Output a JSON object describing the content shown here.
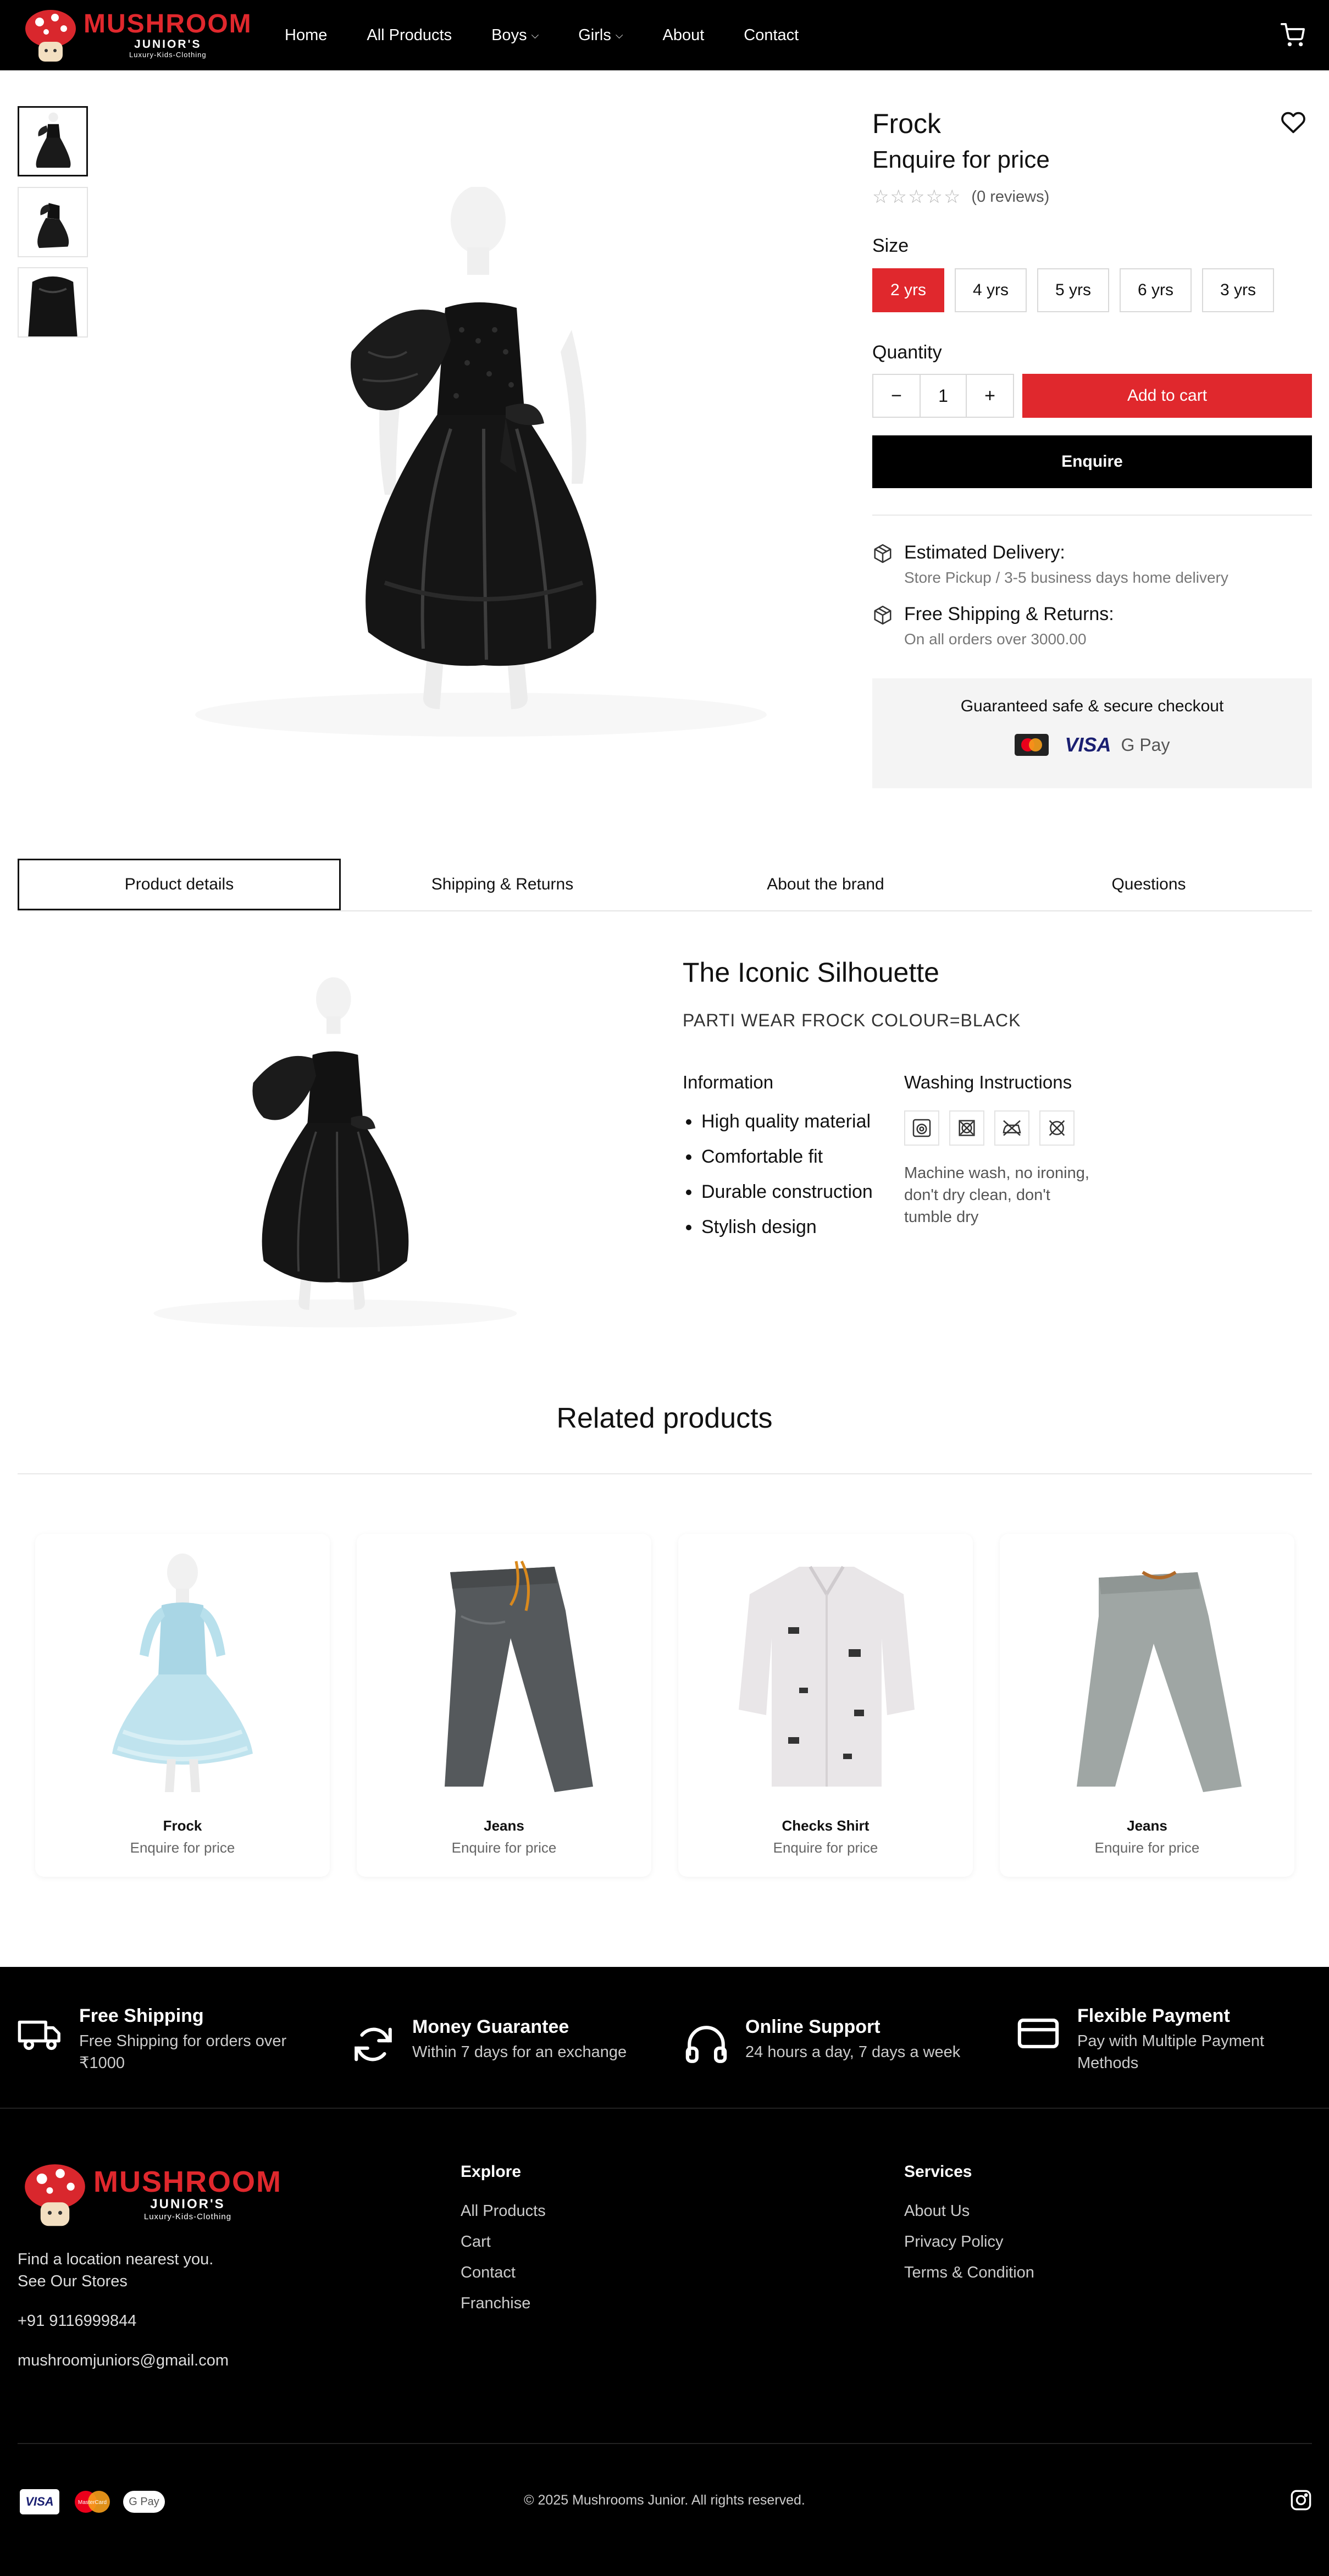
{
  "brand": {
    "name_main": "MUSHROOM",
    "name_sub": "JUNIOR'S",
    "tagline": "Luxury-Kids-Clothing"
  },
  "nav": {
    "items": [
      {
        "label": "Home"
      },
      {
        "label": "All Products"
      },
      {
        "label": "Boys"
      },
      {
        "label": "Girls"
      },
      {
        "label": "About"
      },
      {
        "label": "Contact"
      }
    ]
  },
  "product": {
    "title": "Frock",
    "price": "Enquire for price",
    "reviews": "(0 reviews)",
    "rating": 0,
    "size_label": "Size",
    "sizes": [
      "2 yrs",
      "4 yrs",
      "5 yrs",
      "6 yrs",
      "3 yrs"
    ],
    "selected_size": "2 yrs",
    "quantity_label": "Quantity",
    "quantity": "1",
    "add_to_cart": "Add to cart",
    "enquire": "Enquire",
    "delivery_title": "Estimated Delivery:",
    "delivery_text": "Store Pickup / 3-5 business days home delivery",
    "shipping_title": "Free Shipping & Returns:",
    "shipping_text": "On all orders over 3000.00",
    "secure_text": "Guaranteed safe & secure checkout",
    "secure_gpay": "G Pay",
    "secure_visa": "VISA"
  },
  "tabs": [
    {
      "label": "Product details"
    },
    {
      "label": "Shipping & Returns"
    },
    {
      "label": "About the brand"
    },
    {
      "label": "Questions"
    }
  ],
  "details": {
    "heading": "The Iconic Silhouette",
    "description": "PARTI WEAR FROCK COLOUR=BLACK",
    "info_title": "Information",
    "features": [
      "High quality material",
      "Comfortable fit",
      "Durable construction",
      "Stylish design"
    ],
    "washing_title": "Washing Instructions",
    "washing_text": "Machine wash, no ironing, don't dry clean, don't tumble dry"
  },
  "related": {
    "title": "Related products",
    "items": [
      {
        "name": "Frock",
        "price": "Enquire for price"
      },
      {
        "name": "Jeans",
        "price": "Enquire for price"
      },
      {
        "name": "Checks Shirt",
        "price": "Enquire for price"
      },
      {
        "name": "Jeans",
        "price": "Enquire for price"
      }
    ]
  },
  "footer": {
    "features": [
      {
        "title": "Free Shipping",
        "text": "Free Shipping for orders over ₹1000",
        "icon": "truck-icon"
      },
      {
        "title": "Money Guarantee",
        "text": "Within 7 days for an exchange",
        "icon": "refresh-icon"
      },
      {
        "title": "Online Support",
        "text": "24 hours a day, 7 days a week",
        "icon": "headphones-icon"
      },
      {
        "title": "Flexible Payment",
        "text": "Pay with Multiple Payment Methods",
        "icon": "credit-card-icon"
      }
    ],
    "location_line1": "Find a location nearest you.",
    "location_line2": "See Our Stores",
    "phone": "+91 9116999844",
    "email": "mushroomjuniors@gmail.com",
    "explore_title": "Explore",
    "explore_links": [
      "All Products",
      "Cart",
      "Contact",
      "Franchise"
    ],
    "services_title": "Services",
    "services_links": [
      "About Us",
      "Privacy Policy",
      "Terms & Condition"
    ],
    "copyright": "© 2025 Mushrooms Junior. All rights reserved.",
    "pay_visa": "VISA",
    "pay_gpay": "G Pay",
    "pay_mastercard": "MasterCard"
  },
  "colors": {
    "accent": "#e0282d",
    "dark": "#000000",
    "muted": "#777777"
  }
}
